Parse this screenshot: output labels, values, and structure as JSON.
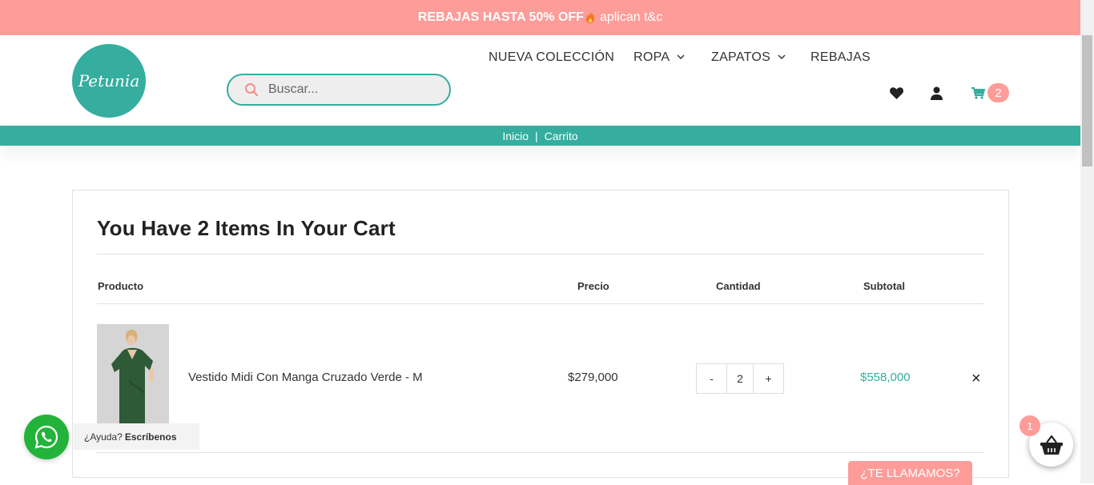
{
  "promo": {
    "bold": "REBAJAS HASTA 50% OFF",
    "flame_icon": "fire-icon",
    "text": "aplican t&c"
  },
  "logo": {
    "text": "Petunia"
  },
  "search": {
    "placeholder": "Buscar..."
  },
  "nav": {
    "items": [
      {
        "label": "NUEVA COLECCIÓN"
      },
      {
        "label": "ROPA"
      },
      {
        "label": "ZAPATOS"
      },
      {
        "label": "REBAJAS"
      }
    ],
    "cart_count": "2"
  },
  "breadcrumb": {
    "home": "Inicio",
    "separator": "|",
    "current": "Carrito"
  },
  "cart": {
    "title": "You Have 2 Items In Your Cart",
    "headers": {
      "product": "Producto",
      "price": "Precio",
      "quantity": "Cantidad",
      "subtotal": "Subtotal"
    },
    "items": [
      {
        "name": "Vestido Midi Con Manga Cruzado Verde - M",
        "price": "$279,000",
        "qty_minus": "-",
        "qty": "2",
        "qty_plus": "+",
        "subtotal": "$558,000",
        "remove": "×"
      }
    ]
  },
  "whatsapp": {
    "prefix": "¿Ayuda?",
    "action": "Escríbenos"
  },
  "callme": {
    "label": "¿TE LLAMAMOS?"
  },
  "basket": {
    "badge": "1"
  },
  "colors": {
    "teal": "#35ad9f",
    "pink": "#fd9c98",
    "whatsapp": "#23b33a"
  }
}
